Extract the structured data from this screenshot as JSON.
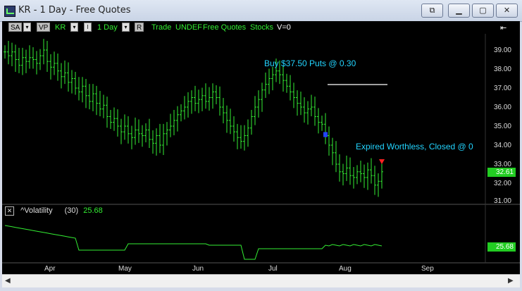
{
  "window": {
    "title": "KR - 1 Day - Free Quotes"
  },
  "toolbar": {
    "sa": "SA",
    "vp": "VP",
    "symbol": "KR",
    "period": "1 Day",
    "r": "R",
    "trade": "Trade",
    "undef": "UNDEF",
    "feed": "Free Quotes",
    "type": "Stocks",
    "volume": "V=0"
  },
  "price_axis": {
    "labels": [
      "39.00",
      "38.00",
      "37.00",
      "36.00",
      "35.00",
      "34.00",
      "33.00",
      "32.00",
      "31.00"
    ],
    "last_price": "32.61"
  },
  "annotations": {
    "buy": "Buy $37.50 Puts @ 0.30",
    "expired": "Expired Worthless, Closed @ 0"
  },
  "indicator": {
    "name": "^Volatility",
    "period": "(30)",
    "value": "25.68",
    "last_value": "25.68"
  },
  "months": [
    "Apr",
    "May",
    "Jun",
    "Jul",
    "Aug",
    "Sep"
  ],
  "colors": {
    "bars": "#33ee33",
    "annotation": "#22d4ff",
    "background": "#000000",
    "signal_buy": "#2244ff",
    "signal_exit": "#ff2222"
  },
  "chart_data": [
    {
      "type": "ohlc",
      "title": "KR - 1 Day",
      "ylim": [
        31,
        39.5
      ],
      "x_labels": [
        "Apr",
        "May",
        "Jun",
        "Jul",
        "Aug",
        "Sep"
      ],
      "closes": [
        38.9,
        38.7,
        38.9,
        38.5,
        38.2,
        38.6,
        38.4,
        38.6,
        38.5,
        38.3,
        38.7,
        39.0,
        38.4,
        38.1,
        38.3,
        37.9,
        37.6,
        37.8,
        37.3,
        37.5,
        37.0,
        36.8,
        37.1,
        36.6,
        36.3,
        36.7,
        36.2,
        35.9,
        36.1,
        35.5,
        35.2,
        35.4,
        35.0,
        34.7,
        35.0,
        34.6,
        34.4,
        34.8,
        34.6,
        34.5,
        34.8,
        34.3,
        34.1,
        34.5,
        34.0,
        34.6,
        34.8,
        35.0,
        35.3,
        35.6,
        35.8,
        36.0,
        36.3,
        36.5,
        36.2,
        36.4,
        36.6,
        36.3,
        36.5,
        36.8,
        36.5,
        36.0,
        35.7,
        35.3,
        35.0,
        34.7,
        34.4,
        34.2,
        34.5,
        34.9,
        35.5,
        36.0,
        36.4,
        36.9,
        37.2,
        37.5,
        37.7,
        37.9,
        37.7,
        37.4,
        37.1,
        36.8,
        36.5,
        36.2,
        36.0,
        35.7,
        35.9,
        36.0,
        35.5,
        35.2,
        35.1,
        34.5,
        34.0,
        33.6,
        33.0,
        32.6,
        32.5,
        32.8,
        32.4,
        32.3,
        32.6,
        32.5,
        32.3,
        32.7,
        32.4,
        31.9,
        32.1,
        32.6
      ],
      "volatility_last": 25.68
    }
  ]
}
